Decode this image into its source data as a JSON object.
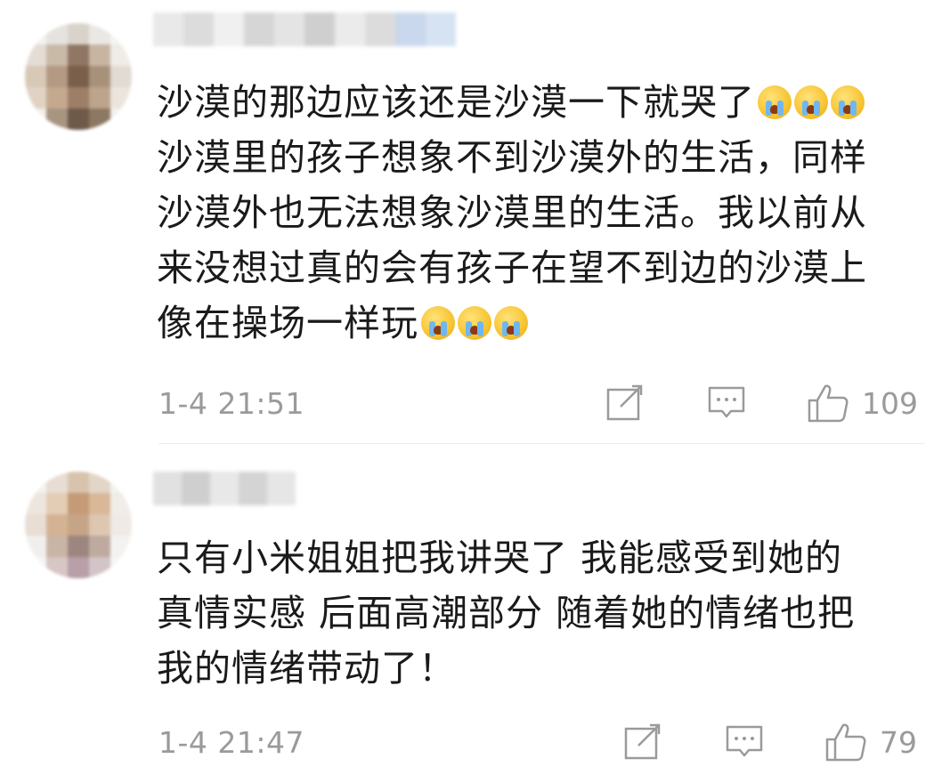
{
  "comments": [
    {
      "lines": [
        "沙漠的那边应该还是沙漠一下就哭了",
        "沙漠里的孩子想象不到沙漠外的生活，同样",
        "沙漠外也无法想象沙漠里的生活。我以前从",
        "来没想过真的会有孩子在望不到边的沙漠上",
        "像在操场一样玩"
      ],
      "line1_emoji_count": 3,
      "line5_emoji_count": 3,
      "time": "1-4 21:51",
      "likes": "109"
    },
    {
      "lines": [
        "只有小米姐姐把我讲哭了 我能感受到她的",
        "真情实感 后面高潮部分 随着她的情绪也把",
        "我的情绪带动了！"
      ],
      "time": "1-4 21:47",
      "likes": "79"
    }
  ],
  "icons": {
    "emoji": "loudly-crying-face-icon",
    "edit": "share-edit-icon",
    "reply": "comment-reply-icon",
    "like": "thumbs-up-icon"
  },
  "colors": {
    "text": "#1a1a1a",
    "meta": "#9a9a9a",
    "divider": "#ececec"
  }
}
